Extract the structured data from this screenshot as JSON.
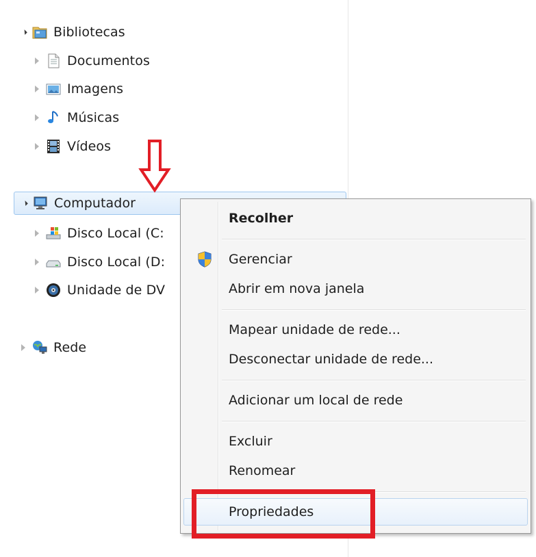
{
  "tree": {
    "libraries": {
      "label": "Bibliotecas",
      "icon": "libraries-icon",
      "expanded": true
    },
    "documents": {
      "label": "Documentos",
      "icon": "document-icon"
    },
    "images": {
      "label": "Imagens",
      "icon": "pictures-icon"
    },
    "music": {
      "label": "Músicas",
      "icon": "music-icon"
    },
    "videos": {
      "label": "Vídeos",
      "icon": "video-icon"
    },
    "computer": {
      "label": "Computador",
      "icon": "computer-icon",
      "expanded": true,
      "selected": true
    },
    "disk_c": {
      "label": "Disco Local (C:",
      "icon": "windows-drive-icon"
    },
    "disk_d": {
      "label": "Disco Local (D:",
      "icon": "drive-icon"
    },
    "dvd": {
      "label": "Unidade de DV",
      "icon": "dvd-icon"
    },
    "network": {
      "label": "Rede",
      "icon": "network-icon"
    }
  },
  "context_menu": {
    "collapse": "Recolher",
    "manage": "Gerenciar",
    "open_new_window": "Abrir em nova janela",
    "map_drive": "Mapear unidade de rede...",
    "disconnect_drive": "Desconectar unidade de rede...",
    "add_network_location": "Adicionar um local de rede",
    "delete": "Excluir",
    "rename": "Renomear",
    "properties": "Propriedades"
  },
  "annotations": {
    "arrow_color": "#e21e26",
    "highlight_color": "#e21e26"
  }
}
